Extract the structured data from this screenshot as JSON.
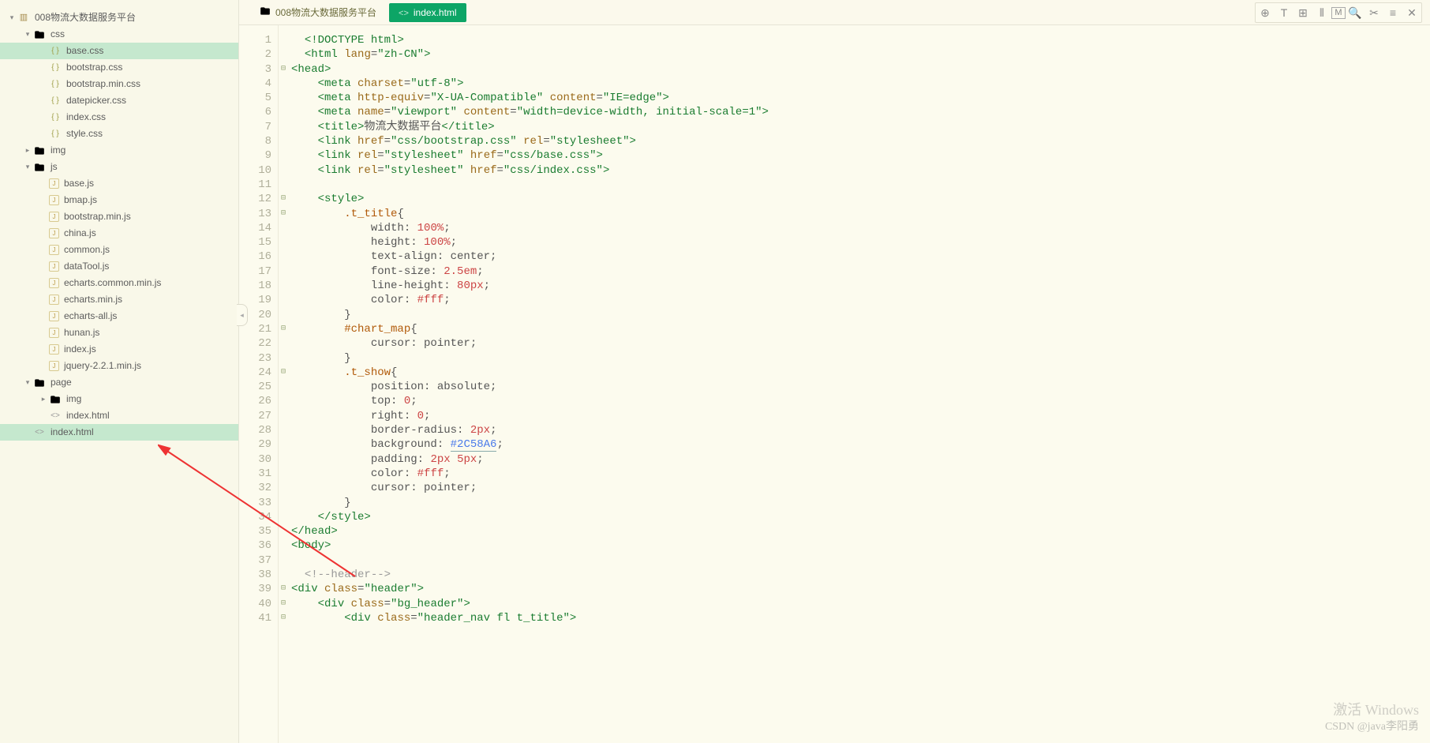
{
  "tree": {
    "root": "008物流大数据服务平台",
    "css_folder": "css",
    "css_files": [
      "base.css",
      "bootstrap.css",
      "bootstrap.min.css",
      "datepicker.css",
      "index.css",
      "style.css"
    ],
    "img_folder": "img",
    "js_folder": "js",
    "js_files": [
      "base.js",
      "bmap.js",
      "bootstrap.min.js",
      "china.js",
      "common.js",
      "dataTool.js",
      "echarts.common.min.js",
      "echarts.min.js",
      "echarts-all.js",
      "hunan.js",
      "index.js",
      "jquery-2.2.1.min.js"
    ],
    "page_folder": "page",
    "page_img": "img",
    "page_index": "index.html",
    "root_index": "index.html"
  },
  "tabs": {
    "t1": "008物流大数据服务平台",
    "t2": "index.html"
  },
  "gutter": [
    "1",
    "2",
    "3",
    "4",
    "5",
    "6",
    "7",
    "8",
    "9",
    "10",
    "11",
    "12",
    "13",
    "14",
    "15",
    "16",
    "17",
    "18",
    "19",
    "20",
    "21",
    "22",
    "23",
    "24",
    "25",
    "26",
    "27",
    "28",
    "29",
    "30",
    "31",
    "32",
    "33",
    "34",
    "35",
    "36",
    "37",
    "38",
    "39",
    "40",
    "41"
  ],
  "code": {
    "l1": {
      "p": "  ",
      "a": "<!DOCTYPE ",
      "b": "html",
      "c": ">"
    },
    "l2": {
      "p": "  ",
      "a": "<html ",
      "b": "lang",
      "c": "=",
      "d": "\"zh-CN\"",
      "e": ">"
    },
    "l3": {
      "p": "",
      "a": "<head>"
    },
    "l4": {
      "p": "    ",
      "a": "<meta ",
      "b": "charset",
      "c": "=",
      "d": "\"utf-8\"",
      "e": ">"
    },
    "l5": {
      "p": "    ",
      "a": "<meta ",
      "b": "http-equiv",
      "c": "=",
      "d": "\"X-UA-Compatible\"",
      "e": " ",
      "f": "content",
      "g": "=",
      "h": "\"IE=edge\"",
      "i": ">"
    },
    "l6": {
      "p": "    ",
      "a": "<meta ",
      "b": "name",
      "c": "=",
      "d": "\"viewport\"",
      "e": " ",
      "f": "content",
      "g": "=",
      "h": "\"width=device-width, initial-scale=1\"",
      "i": ">"
    },
    "l7": {
      "p": "    ",
      "a": "<title>",
      "b": "物流大数据平台",
      "c": "</title>"
    },
    "l8": {
      "p": "    ",
      "a": "<link ",
      "b": "href",
      "c": "=",
      "d": "\"css/bootstrap.css\"",
      "e": " ",
      "f": "rel",
      "g": "=",
      "h": "\"stylesheet\"",
      "i": ">"
    },
    "l9": {
      "p": "    ",
      "a": "<link ",
      "b": "rel",
      "c": "=",
      "d": "\"stylesheet\"",
      "e": " ",
      "f": "href",
      "g": "=",
      "h": "\"css/base.css\"",
      "i": ">"
    },
    "l10": {
      "p": "    ",
      "a": "<link ",
      "b": "rel",
      "c": "=",
      "d": "\"stylesheet\"",
      "e": " ",
      "f": "href",
      "g": "=",
      "h": "\"css/index.css\"",
      "i": ">"
    },
    "l12": {
      "p": "    ",
      "a": "<style>"
    },
    "l13": {
      "p": "        ",
      "a": ".t_title",
      "b": "{"
    },
    "l14": {
      "p": "            ",
      "a": "width",
      "b": ": ",
      "c": "100%",
      "d": ";"
    },
    "l15": {
      "p": "            ",
      "a": "height",
      "b": ": ",
      "c": "100%",
      "d": ";"
    },
    "l16": {
      "p": "            ",
      "a": "text-align",
      "b": ": center;"
    },
    "l17": {
      "p": "            ",
      "a": "font-size",
      "b": ": ",
      "c": "2.5em",
      "d": ";"
    },
    "l18": {
      "p": "            ",
      "a": "line-height",
      "b": ": ",
      "c": "80px",
      "d": ";"
    },
    "l19": {
      "p": "            ",
      "a": "color",
      "b": ": ",
      "c": "#fff",
      "d": ";"
    },
    "l20": {
      "p": "        ",
      "a": "}"
    },
    "l21": {
      "p": "        ",
      "a": "#chart_map",
      "b": "{"
    },
    "l22": {
      "p": "            ",
      "a": "cursor",
      "b": ": pointer;"
    },
    "l23": {
      "p": "        ",
      "a": "}"
    },
    "l24": {
      "p": "        ",
      "a": ".t_show",
      "b": "{"
    },
    "l25": {
      "p": "            ",
      "a": "position",
      "b": ": absolute;"
    },
    "l26": {
      "p": "            ",
      "a": "top",
      "b": ": ",
      "c": "0",
      "d": ";"
    },
    "l27": {
      "p": "            ",
      "a": "right",
      "b": ": ",
      "c": "0",
      "d": ";"
    },
    "l28": {
      "p": "            ",
      "a": "border-radius",
      "b": ": ",
      "c": "2px",
      "d": ";"
    },
    "l29": {
      "p": "            ",
      "a": "background",
      "b": ": ",
      "c": "#2C58A6",
      "d": ";"
    },
    "l30": {
      "p": "            ",
      "a": "padding",
      "b": ": ",
      "c": "2px",
      "d": " ",
      "e": "5px",
      "f": ";"
    },
    "l31": {
      "p": "            ",
      "a": "color",
      "b": ": ",
      "c": "#fff",
      "d": ";"
    },
    "l32": {
      "p": "            ",
      "a": "cursor",
      "b": ": pointer;"
    },
    "l33": {
      "p": "        ",
      "a": "}"
    },
    "l34": {
      "p": "    ",
      "a": "</style>"
    },
    "l35": {
      "p": "",
      "a": "</head>"
    },
    "l36": {
      "p": "",
      "a": "<body>"
    },
    "l38": {
      "p": "  ",
      "a": "<!--header-->"
    },
    "l39": {
      "p": "",
      "a": "<div ",
      "b": "class",
      "c": "=",
      "d": "\"header\"",
      "e": ">"
    },
    "l40": {
      "p": "    ",
      "a": "<div ",
      "b": "class",
      "c": "=",
      "d": "\"bg_header\"",
      "e": ">"
    },
    "l41": {
      "p": "        ",
      "a": "<div ",
      "b": "class",
      "c": "=",
      "d": "\"header_nav fl t_title\"",
      "e": ">"
    }
  },
  "watermark1": "激活 Windows",
  "watermark2": "CSDN @java李阳勇"
}
